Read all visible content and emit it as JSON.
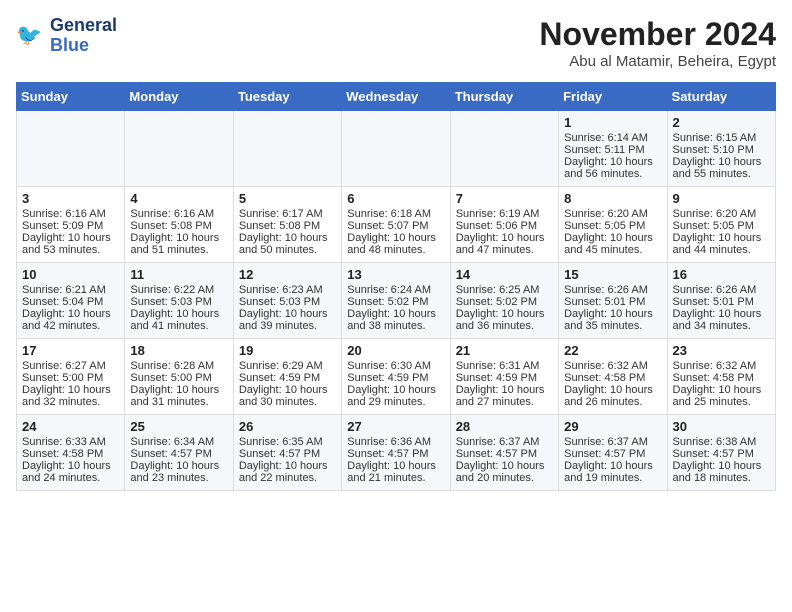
{
  "logo": {
    "line1": "General",
    "line2": "Blue"
  },
  "title": "November 2024",
  "location": "Abu al Matamir, Beheira, Egypt",
  "header_days": [
    "Sunday",
    "Monday",
    "Tuesday",
    "Wednesday",
    "Thursday",
    "Friday",
    "Saturday"
  ],
  "weeks": [
    [
      {
        "day": "",
        "sunrise": "",
        "sunset": "",
        "daylight": ""
      },
      {
        "day": "",
        "sunrise": "",
        "sunset": "",
        "daylight": ""
      },
      {
        "day": "",
        "sunrise": "",
        "sunset": "",
        "daylight": ""
      },
      {
        "day": "",
        "sunrise": "",
        "sunset": "",
        "daylight": ""
      },
      {
        "day": "",
        "sunrise": "",
        "sunset": "",
        "daylight": ""
      },
      {
        "day": "1",
        "sunrise": "Sunrise: 6:14 AM",
        "sunset": "Sunset: 5:11 PM",
        "daylight": "Daylight: 10 hours and 56 minutes."
      },
      {
        "day": "2",
        "sunrise": "Sunrise: 6:15 AM",
        "sunset": "Sunset: 5:10 PM",
        "daylight": "Daylight: 10 hours and 55 minutes."
      }
    ],
    [
      {
        "day": "3",
        "sunrise": "Sunrise: 6:16 AM",
        "sunset": "Sunset: 5:09 PM",
        "daylight": "Daylight: 10 hours and 53 minutes."
      },
      {
        "day": "4",
        "sunrise": "Sunrise: 6:16 AM",
        "sunset": "Sunset: 5:08 PM",
        "daylight": "Daylight: 10 hours and 51 minutes."
      },
      {
        "day": "5",
        "sunrise": "Sunrise: 6:17 AM",
        "sunset": "Sunset: 5:08 PM",
        "daylight": "Daylight: 10 hours and 50 minutes."
      },
      {
        "day": "6",
        "sunrise": "Sunrise: 6:18 AM",
        "sunset": "Sunset: 5:07 PM",
        "daylight": "Daylight: 10 hours and 48 minutes."
      },
      {
        "day": "7",
        "sunrise": "Sunrise: 6:19 AM",
        "sunset": "Sunset: 5:06 PM",
        "daylight": "Daylight: 10 hours and 47 minutes."
      },
      {
        "day": "8",
        "sunrise": "Sunrise: 6:20 AM",
        "sunset": "Sunset: 5:05 PM",
        "daylight": "Daylight: 10 hours and 45 minutes."
      },
      {
        "day": "9",
        "sunrise": "Sunrise: 6:20 AM",
        "sunset": "Sunset: 5:05 PM",
        "daylight": "Daylight: 10 hours and 44 minutes."
      }
    ],
    [
      {
        "day": "10",
        "sunrise": "Sunrise: 6:21 AM",
        "sunset": "Sunset: 5:04 PM",
        "daylight": "Daylight: 10 hours and 42 minutes."
      },
      {
        "day": "11",
        "sunrise": "Sunrise: 6:22 AM",
        "sunset": "Sunset: 5:03 PM",
        "daylight": "Daylight: 10 hours and 41 minutes."
      },
      {
        "day": "12",
        "sunrise": "Sunrise: 6:23 AM",
        "sunset": "Sunset: 5:03 PM",
        "daylight": "Daylight: 10 hours and 39 minutes."
      },
      {
        "day": "13",
        "sunrise": "Sunrise: 6:24 AM",
        "sunset": "Sunset: 5:02 PM",
        "daylight": "Daylight: 10 hours and 38 minutes."
      },
      {
        "day": "14",
        "sunrise": "Sunrise: 6:25 AM",
        "sunset": "Sunset: 5:02 PM",
        "daylight": "Daylight: 10 hours and 36 minutes."
      },
      {
        "day": "15",
        "sunrise": "Sunrise: 6:26 AM",
        "sunset": "Sunset: 5:01 PM",
        "daylight": "Daylight: 10 hours and 35 minutes."
      },
      {
        "day": "16",
        "sunrise": "Sunrise: 6:26 AM",
        "sunset": "Sunset: 5:01 PM",
        "daylight": "Daylight: 10 hours and 34 minutes."
      }
    ],
    [
      {
        "day": "17",
        "sunrise": "Sunrise: 6:27 AM",
        "sunset": "Sunset: 5:00 PM",
        "daylight": "Daylight: 10 hours and 32 minutes."
      },
      {
        "day": "18",
        "sunrise": "Sunrise: 6:28 AM",
        "sunset": "Sunset: 5:00 PM",
        "daylight": "Daylight: 10 hours and 31 minutes."
      },
      {
        "day": "19",
        "sunrise": "Sunrise: 6:29 AM",
        "sunset": "Sunset: 4:59 PM",
        "daylight": "Daylight: 10 hours and 30 minutes."
      },
      {
        "day": "20",
        "sunrise": "Sunrise: 6:30 AM",
        "sunset": "Sunset: 4:59 PM",
        "daylight": "Daylight: 10 hours and 29 minutes."
      },
      {
        "day": "21",
        "sunrise": "Sunrise: 6:31 AM",
        "sunset": "Sunset: 4:59 PM",
        "daylight": "Daylight: 10 hours and 27 minutes."
      },
      {
        "day": "22",
        "sunrise": "Sunrise: 6:32 AM",
        "sunset": "Sunset: 4:58 PM",
        "daylight": "Daylight: 10 hours and 26 minutes."
      },
      {
        "day": "23",
        "sunrise": "Sunrise: 6:32 AM",
        "sunset": "Sunset: 4:58 PM",
        "daylight": "Daylight: 10 hours and 25 minutes."
      }
    ],
    [
      {
        "day": "24",
        "sunrise": "Sunrise: 6:33 AM",
        "sunset": "Sunset: 4:58 PM",
        "daylight": "Daylight: 10 hours and 24 minutes."
      },
      {
        "day": "25",
        "sunrise": "Sunrise: 6:34 AM",
        "sunset": "Sunset: 4:57 PM",
        "daylight": "Daylight: 10 hours and 23 minutes."
      },
      {
        "day": "26",
        "sunrise": "Sunrise: 6:35 AM",
        "sunset": "Sunset: 4:57 PM",
        "daylight": "Daylight: 10 hours and 22 minutes."
      },
      {
        "day": "27",
        "sunrise": "Sunrise: 6:36 AM",
        "sunset": "Sunset: 4:57 PM",
        "daylight": "Daylight: 10 hours and 21 minutes."
      },
      {
        "day": "28",
        "sunrise": "Sunrise: 6:37 AM",
        "sunset": "Sunset: 4:57 PM",
        "daylight": "Daylight: 10 hours and 20 minutes."
      },
      {
        "day": "29",
        "sunrise": "Sunrise: 6:37 AM",
        "sunset": "Sunset: 4:57 PM",
        "daylight": "Daylight: 10 hours and 19 minutes."
      },
      {
        "day": "30",
        "sunrise": "Sunrise: 6:38 AM",
        "sunset": "Sunset: 4:57 PM",
        "daylight": "Daylight: 10 hours and 18 minutes."
      }
    ]
  ]
}
